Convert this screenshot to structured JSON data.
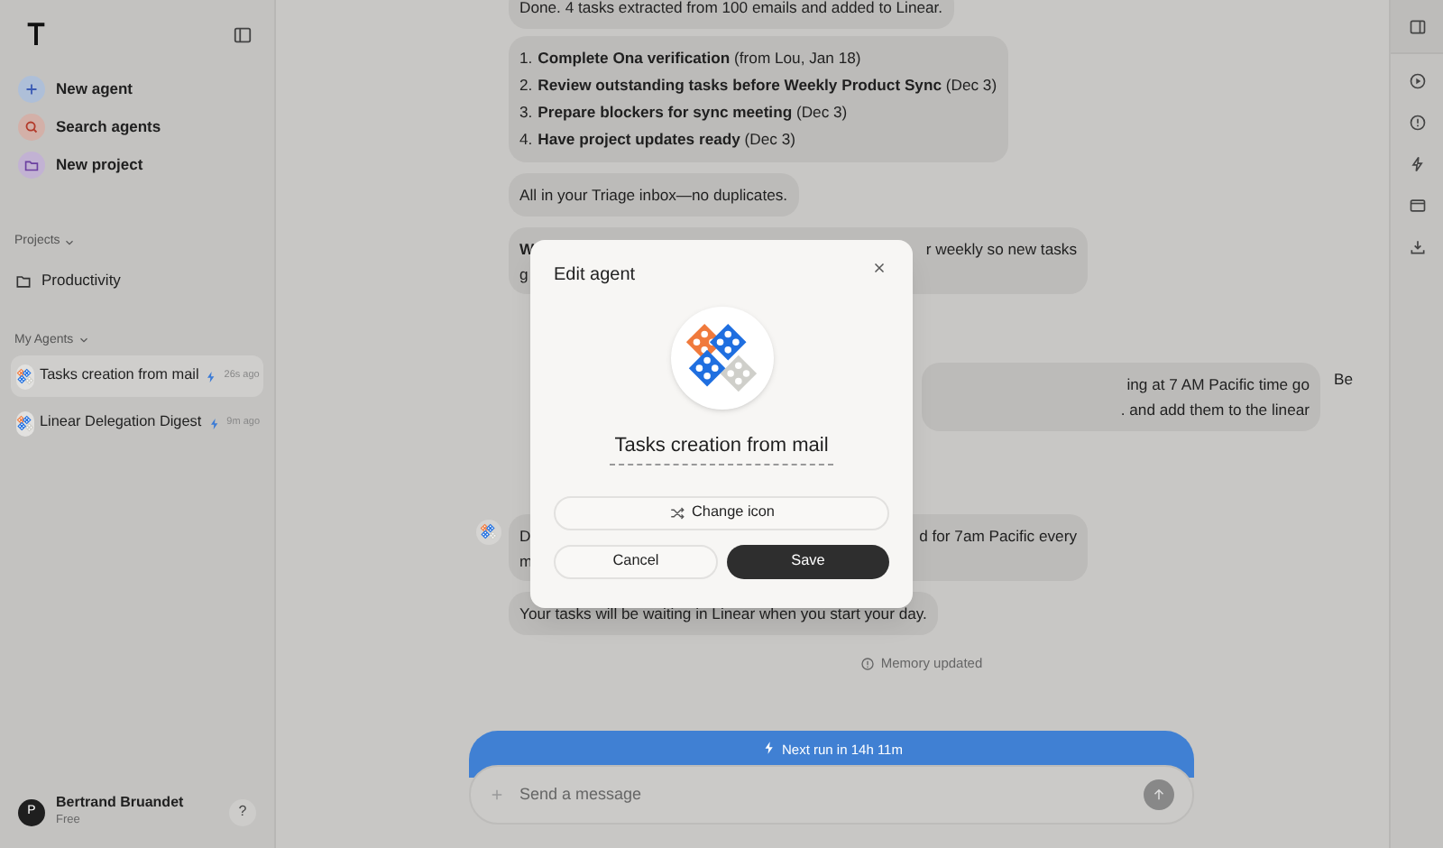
{
  "sidebar": {
    "actions": [
      {
        "kind": "agent",
        "label": "New agent"
      },
      {
        "kind": "search",
        "label": "Search agents"
      },
      {
        "kind": "project",
        "label": "New project"
      }
    ],
    "projects_header": "Projects",
    "projects": [
      "Productivity"
    ],
    "agents_header": "My Agents",
    "agents": [
      {
        "name": "Tasks creation from mail",
        "time": "26s ago",
        "selected": true
      },
      {
        "name": "Linear Delegation Digest",
        "time": "9m ago",
        "selected": false
      }
    ],
    "user": {
      "initial": "P",
      "name": "Bertrand Bruandet",
      "plan": "Free"
    },
    "help": "?"
  },
  "chat": {
    "messages": [
      {
        "kind": "text",
        "text": "Done. 4 tasks extracted from 100 emails and added to Linear."
      },
      {
        "kind": "list",
        "items": [
          {
            "number": "1.",
            "text": "**Complete Ona verification** (from Lou, Jan 18)"
          },
          {
            "number": "2.",
            "text": "**Review outstanding tasks before Weekly Product Sync** (Dec 3)"
          },
          {
            "number": "3.",
            "text": "**Prepare blockers for sync meeting** (Dec 3)"
          },
          {
            "number": "4.",
            "text": "**Have project updates ready** (Dec 3)"
          }
        ]
      },
      {
        "kind": "text",
        "text": "All in your Triage inbox—no duplicates."
      },
      {
        "kind": "split",
        "left": [
          "**W**",
          "g"
        ],
        "right": [
          "r weekly so new tasks"
        ]
      },
      {
        "kind": "user",
        "right": [
          "ing at 7 AM Pacific time go",
          ". and add them to the linear"
        ],
        "after": "Be"
      },
      {
        "kind": "split",
        "avatar": true,
        "left": [
          "D",
          "m"
        ],
        "right": [
          "d for 7am Pacific every"
        ]
      },
      {
        "kind": "text",
        "text": "Your tasks will be waiting in Linear when you start your day."
      },
      {
        "kind": "note",
        "text": "Memory updated"
      }
    ],
    "banner": "Next run in 14h 11m",
    "composer": {
      "placeholder": "Send a message"
    }
  },
  "dialog": {
    "title": "Edit agent",
    "name": "Tasks creation from mail",
    "change_icon": "Change icon",
    "cancel": "Cancel",
    "save": "Save"
  }
}
